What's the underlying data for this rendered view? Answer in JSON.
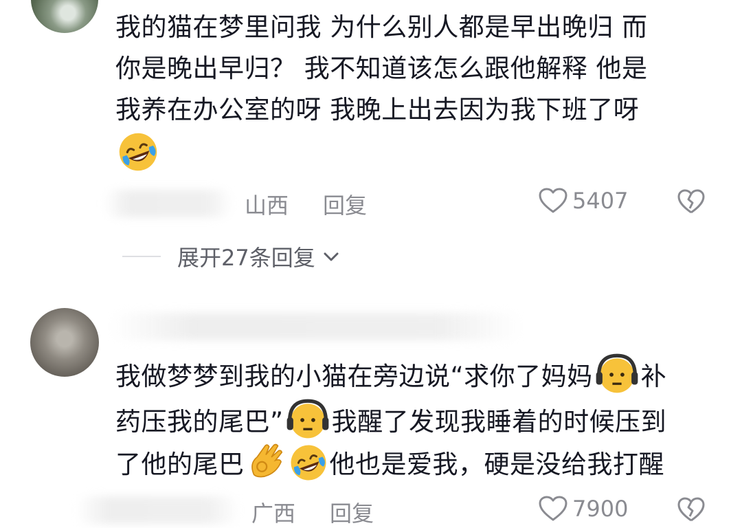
{
  "comments": [
    {
      "text_line1": "我的猫在梦里问我 为什么别人都是早出晚归 而",
      "text_line2": "你是晚出早归？ 我不知道该怎么跟他解释 他是",
      "text_line3": "我养在办公室的呀 我晚上出去因为我下班了呀",
      "location": "山西",
      "reply_label": "回复",
      "likes": "5407"
    },
    {
      "text_line1a": "我做梦梦到我的小猫在旁边说“求你了妈妈",
      "text_line1b": "补",
      "text_line2a": "药压我的尾巴”",
      "text_line2b": "我醒了发现我睡着的时候压到",
      "text_line3a": "了他的尾巴",
      "text_line3b": "他也是爱我，硬是没给我打醒",
      "location": "广西",
      "reply_label": "回复",
      "likes": "7900"
    }
  ],
  "expand_replies": "展开27条回复",
  "icons": {
    "like": "heart-outline-icon",
    "dislike": "broken-heart-icon",
    "chevron": "chevron-down-icon",
    "emoji_laugh": "laughing-crying-emoji",
    "emoji_worried": "headphone-worried-emoji",
    "emoji_ok": "ok-hand-emoji"
  },
  "colors": {
    "text": "#161823",
    "meta": "#8a8b91",
    "emoji_yellow": "#f7c23a"
  }
}
